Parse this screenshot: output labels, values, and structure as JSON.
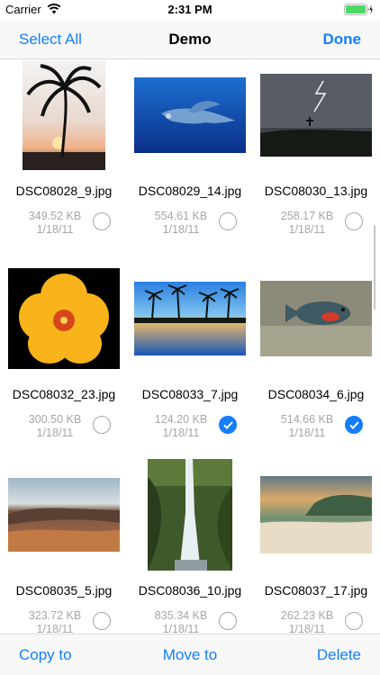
{
  "status_bar": {
    "carrier": "Carrier",
    "time": "2:31 PM"
  },
  "nav": {
    "left": "Select All",
    "title": "Demo",
    "right": "Done"
  },
  "photos": [
    {
      "name": "DSC08028_9.jpg",
      "size": "349.52 KB",
      "date": "1/18/11",
      "selected": false,
      "image": "palm-tree-sunset"
    },
    {
      "name": "DSC08029_14.jpg",
      "size": "554.61 KB",
      "date": "1/18/11",
      "selected": false,
      "image": "whale-underwater"
    },
    {
      "name": "DSC08030_13.jpg",
      "size": "258.17 KB",
      "date": "1/18/11",
      "selected": false,
      "image": "lightning-storm"
    },
    {
      "name": "DSC08032_23.jpg",
      "size": "300.50 KB",
      "date": "1/18/11",
      "selected": false,
      "image": "yellow-hibiscus"
    },
    {
      "name": "DSC08033_7.jpg",
      "size": "124.20 KB",
      "date": "1/18/11",
      "selected": true,
      "image": "palm-lagoon-dusk"
    },
    {
      "name": "DSC08034_6.jpg",
      "size": "514.66 KB",
      "date": "1/18/11",
      "selected": true,
      "image": "reef-fish"
    },
    {
      "name": "DSC08035_5.jpg",
      "size": "323.72 KB",
      "date": "1/18/11",
      "selected": false,
      "image": "volcanic-crater"
    },
    {
      "name": "DSC08036_10.jpg",
      "size": "835.34 KB",
      "date": "1/18/11",
      "selected": false,
      "image": "waterfall"
    },
    {
      "name": "DSC08037_17.jpg",
      "size": "262.23 KB",
      "date": "1/18/11",
      "selected": false,
      "image": "beach-sunset"
    }
  ],
  "toolbar": {
    "copy": "Copy to",
    "move": "Move to",
    "delete": "Delete"
  },
  "colors": {
    "accent": "#147efb",
    "secondary_text": "#a6a6a6",
    "bar_background": "#f8f8f8",
    "battery": "#4cd964"
  }
}
